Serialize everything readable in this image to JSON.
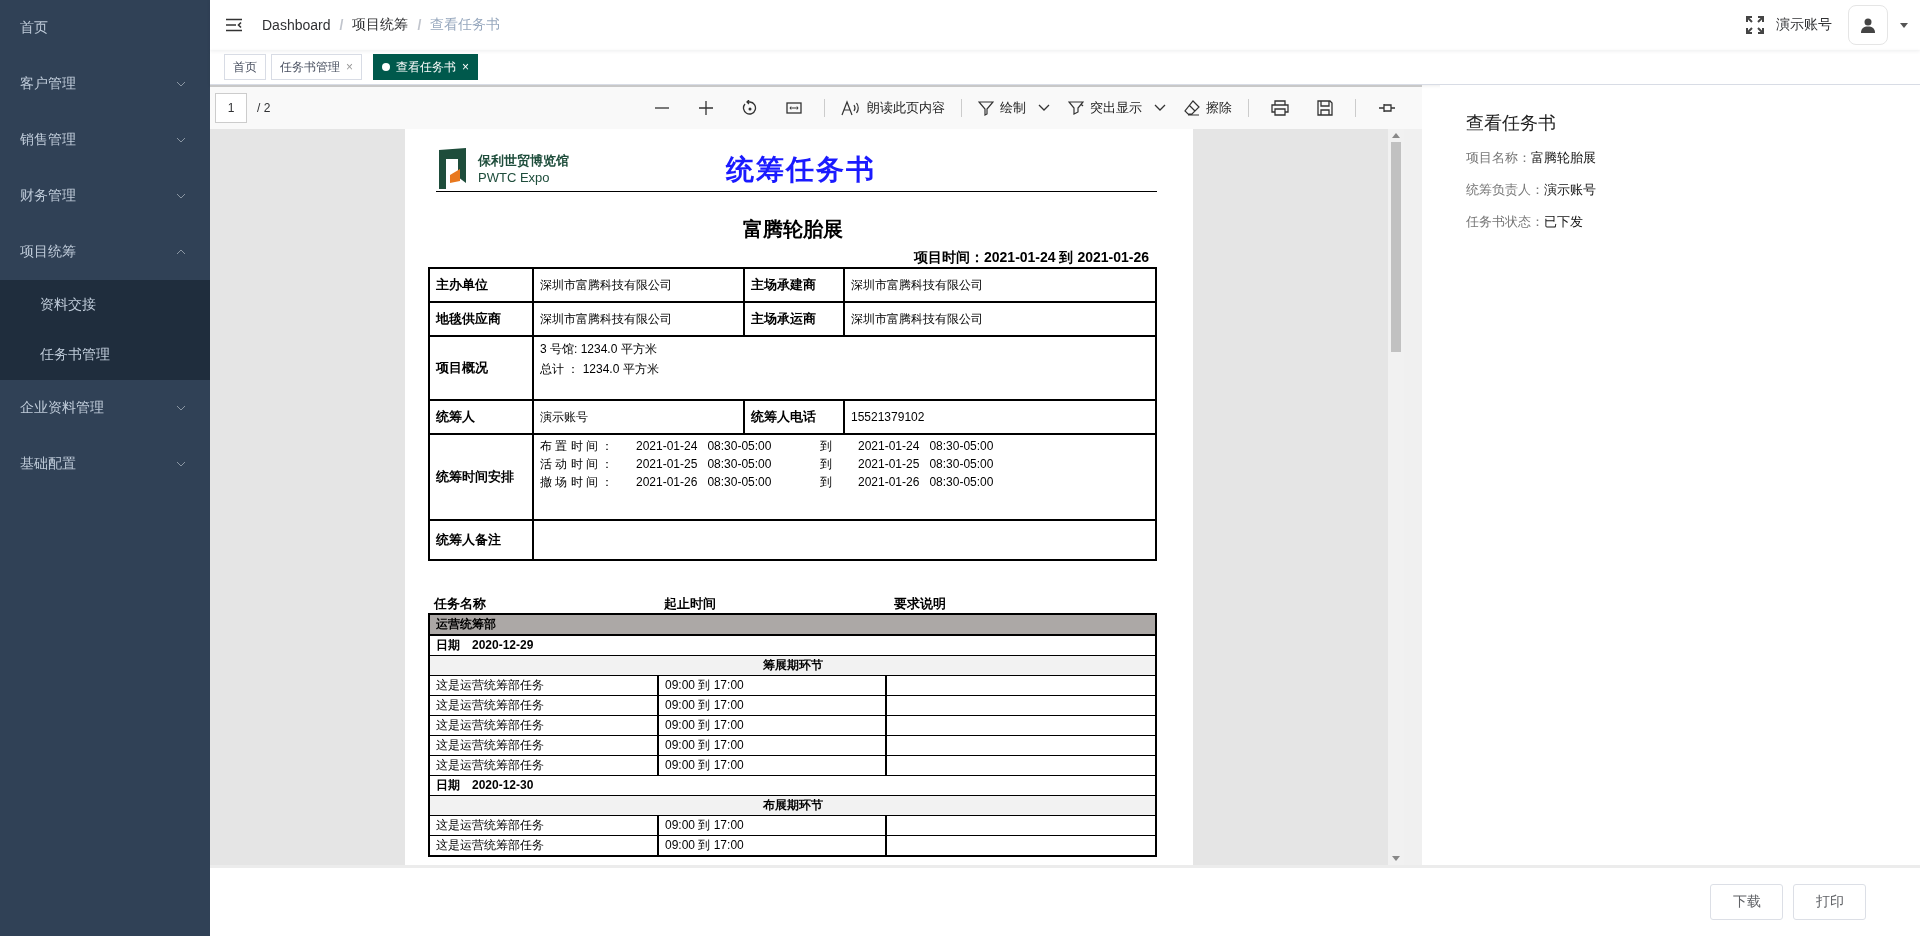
{
  "sidebar": {
    "items": [
      {
        "label": "首页",
        "kind": "link"
      },
      {
        "label": "客户管理",
        "kind": "group",
        "expanded": false
      },
      {
        "label": "销售管理",
        "kind": "group",
        "expanded": false
      },
      {
        "label": "财务管理",
        "kind": "group",
        "expanded": false
      },
      {
        "label": "项目统筹",
        "kind": "group",
        "expanded": true,
        "children": [
          {
            "label": "资料交接"
          },
          {
            "label": "任务书管理"
          }
        ]
      },
      {
        "label": "企业资料管理",
        "kind": "group",
        "expanded": false
      },
      {
        "label": "基础配置",
        "kind": "group",
        "expanded": false
      }
    ]
  },
  "header": {
    "breadcrumb": [
      "Dashboard",
      "项目统筹",
      "查看任务书"
    ],
    "separators": [
      "/",
      "/"
    ],
    "user": "演示账号"
  },
  "tabs": [
    {
      "label": "首页",
      "selected": false
    },
    {
      "label": "任务书管理",
      "selected": false,
      "close": "×"
    },
    {
      "label": "查看任务书",
      "selected": true,
      "close": "×"
    }
  ],
  "pdf_toolbar": {
    "page": "1",
    "page_count": "/ 2",
    "read_aloud": "朗读此页内容",
    "draw": "绘制",
    "highlight": "突出显示",
    "erase": "擦除"
  },
  "document": {
    "logo": {
      "name": "保利世贸博览馆",
      "sub": "PWTC Expo"
    },
    "title": "统筹任务书",
    "project": "富腾轮胎展",
    "period": "项目时间：2021-01-24 到 2021-01-26",
    "info": [
      {
        "kind": "pair",
        "label": "主办单位",
        "value": "深圳市富腾科技有限公司",
        "label2": "主场承建商",
        "value2": "深圳市富腾科技有限公司"
      },
      {
        "kind": "pair",
        "label": "地毯供应商",
        "value": "深圳市富腾科技有限公司",
        "label2": "主场承运商",
        "value2": "深圳市富腾科技有限公司"
      },
      {
        "kind": "lines",
        "label": "项目概况",
        "lines": [
          "3 号馆: 1234.0 平方米",
          "总计  ：  1234.0 平方米"
        ]
      },
      {
        "kind": "pair",
        "label": "统筹人",
        "value": "演示账号",
        "label2": "统筹人电话",
        "value2": "15521379102"
      },
      {
        "kind": "schedule",
        "label": "统筹时间安排",
        "schedule": [
          {
            "name": "布 置 时 间 ：",
            "start": "2021-01-24   08:30-05:00",
            "to": "到",
            "end": "2021-01-24   08:30-05:00"
          },
          {
            "name": "活 动 时 间 ：",
            "start": "2021-01-25   08:30-05:00",
            "to": "到",
            "end": "2021-01-25   08:30-05:00"
          },
          {
            "name": "撤 场 时 间 ：",
            "start": "2021-01-26   08:30-05:00",
            "to": "到",
            "end": "2021-01-26   08:30-05:00"
          }
        ]
      },
      {
        "kind": "blank",
        "label": "统筹人备注"
      }
    ],
    "task_headers": [
      "任务名称",
      "起止时间",
      "要求说明"
    ],
    "department": "运营统筹部",
    "days": [
      {
        "label": "日期",
        "date": "2020-12-29",
        "phase": "筹展期环节",
        "tasks": [
          {
            "name": "这是运营统筹部任务",
            "time": "09:00 到 17:00"
          },
          {
            "name": "这是运营统筹部任务",
            "time": "09:00 到 17:00"
          },
          {
            "name": "这是运营统筹部任务",
            "time": "09:00 到 17:00"
          },
          {
            "name": "这是运营统筹部任务",
            "time": "09:00 到 17:00"
          },
          {
            "name": "这是运营统筹部任务",
            "time": "09:00 到 17:00"
          }
        ]
      },
      {
        "label": "日期",
        "date": "2020-12-30",
        "phase": "布展期环节",
        "tasks": [
          {
            "name": "这是运营统筹部任务",
            "time": "09:00 到 17:00"
          },
          {
            "name": "这是运营统筹部任务",
            "time": "09:00 到 17:00"
          }
        ]
      }
    ]
  },
  "detail_panel": {
    "title": "查看任务书",
    "fields": [
      {
        "label": "项目名称：",
        "value": "富腾轮胎展"
      },
      {
        "label": "统筹负责人：",
        "value": "演示账号"
      },
      {
        "label": "任务书状态：",
        "value": "已下发"
      }
    ]
  },
  "footer_buttons": [
    "下载",
    "打印"
  ]
}
